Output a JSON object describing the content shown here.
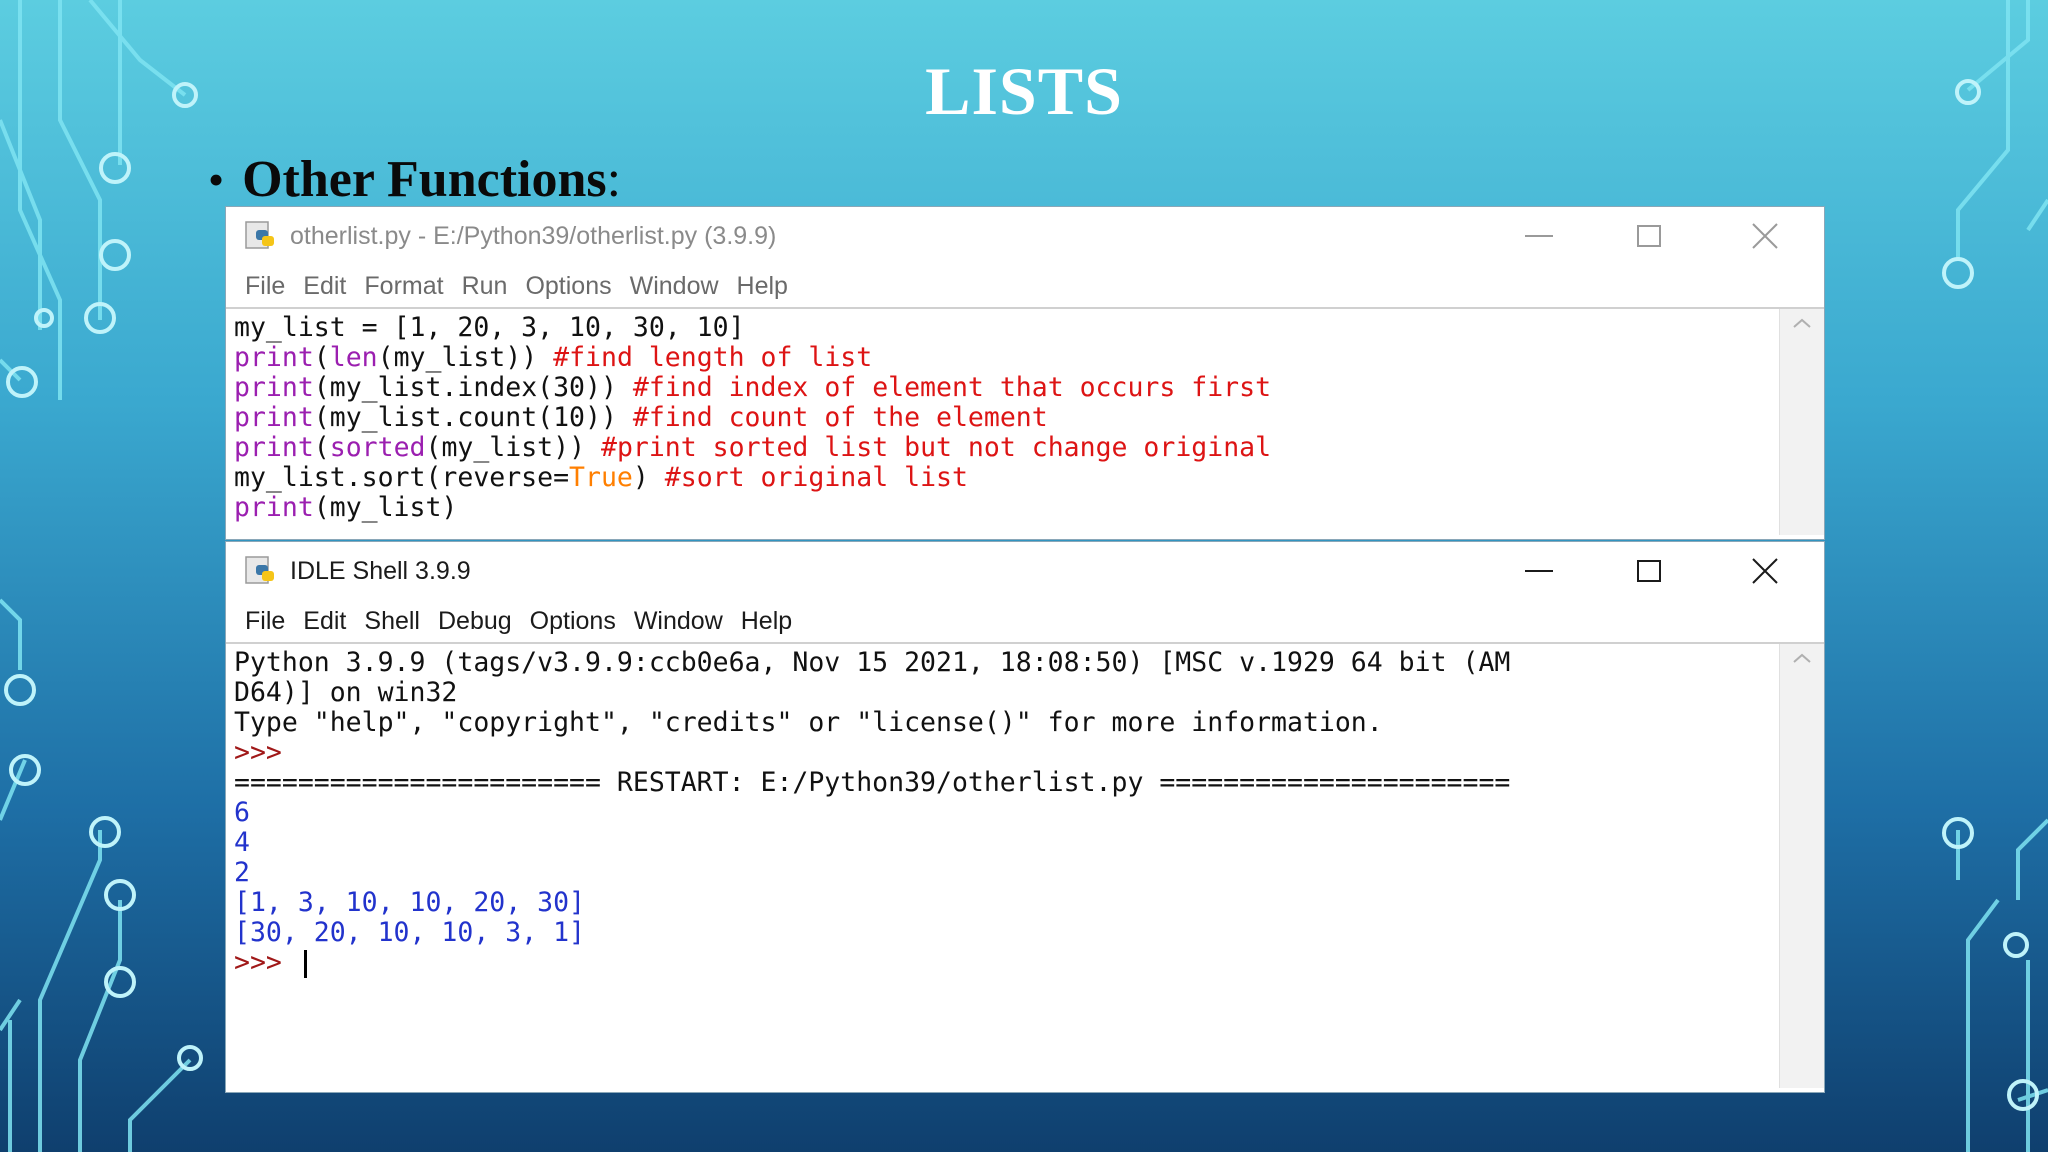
{
  "slide": {
    "title": "LISTS",
    "bullet": "Other Functions",
    "bullet_suffix": ":"
  },
  "editor": {
    "title": "otherlist.py - E:/Python39/otherlist.py (3.9.9)",
    "menu": [
      "File",
      "Edit",
      "Format",
      "Run",
      "Options",
      "Window",
      "Help"
    ],
    "code": {
      "l1": "my_list = [1, 20, 3, 10, 30, 10]",
      "l2_fn": "print",
      "l2_a": "(",
      "l2_fn2": "len",
      "l2_b": "(my_list)) ",
      "l2_c": "#find length of list",
      "l3_fn": "print",
      "l3_b": "(my_list.index(30)) ",
      "l3_c": "#find index of element that occurs first",
      "l4_fn": "print",
      "l4_b": "(my_list.count(10)) ",
      "l4_c": "#find count of the element",
      "l5_fn": "print",
      "l5_a": "(",
      "l5_fn2": "sorted",
      "l5_b": "(my_list)) ",
      "l5_c": "#print sorted list but not change original",
      "l6_a": "my_list.sort(reverse=",
      "l6_bool": "True",
      "l6_b": ") ",
      "l6_c": "#sort original list",
      "l7_fn": "print",
      "l7_b": "(my_list)"
    }
  },
  "shell": {
    "title": "IDLE Shell 3.9.9",
    "menu": [
      "File",
      "Edit",
      "Shell",
      "Debug",
      "Options",
      "Window",
      "Help"
    ],
    "lines": {
      "banner1": "Python 3.9.9 (tags/v3.9.9:ccb0e6a, Nov 15 2021, 18:08:50) [MSC v.1929 64 bit (AM",
      "banner2": "D64)] on win32",
      "banner3": "Type \"help\", \"copyright\", \"credits\" or \"license()\" for more information.",
      "prompt1": ">>>",
      "restart": "======================= RESTART: E:/Python39/otherlist.py ======================",
      "out1": "6",
      "out2": "4",
      "out3": "2",
      "out4": "[1, 3, 10, 10, 20, 30]",
      "out5": "[30, 20, 10, 10, 3, 1]",
      "prompt2": ">>> "
    }
  },
  "icons": {
    "app": "python-idle-icon",
    "minimize": "minimize-icon",
    "maximize": "maximize-icon",
    "close": "close-icon",
    "scroll_up": "chevron-up-icon"
  },
  "colors": {
    "keyword": "#9b1fb0",
    "comment": "#dd1414",
    "builtin": "#ff7f00",
    "output": "#2233cc",
    "prompt": "#a01818"
  }
}
